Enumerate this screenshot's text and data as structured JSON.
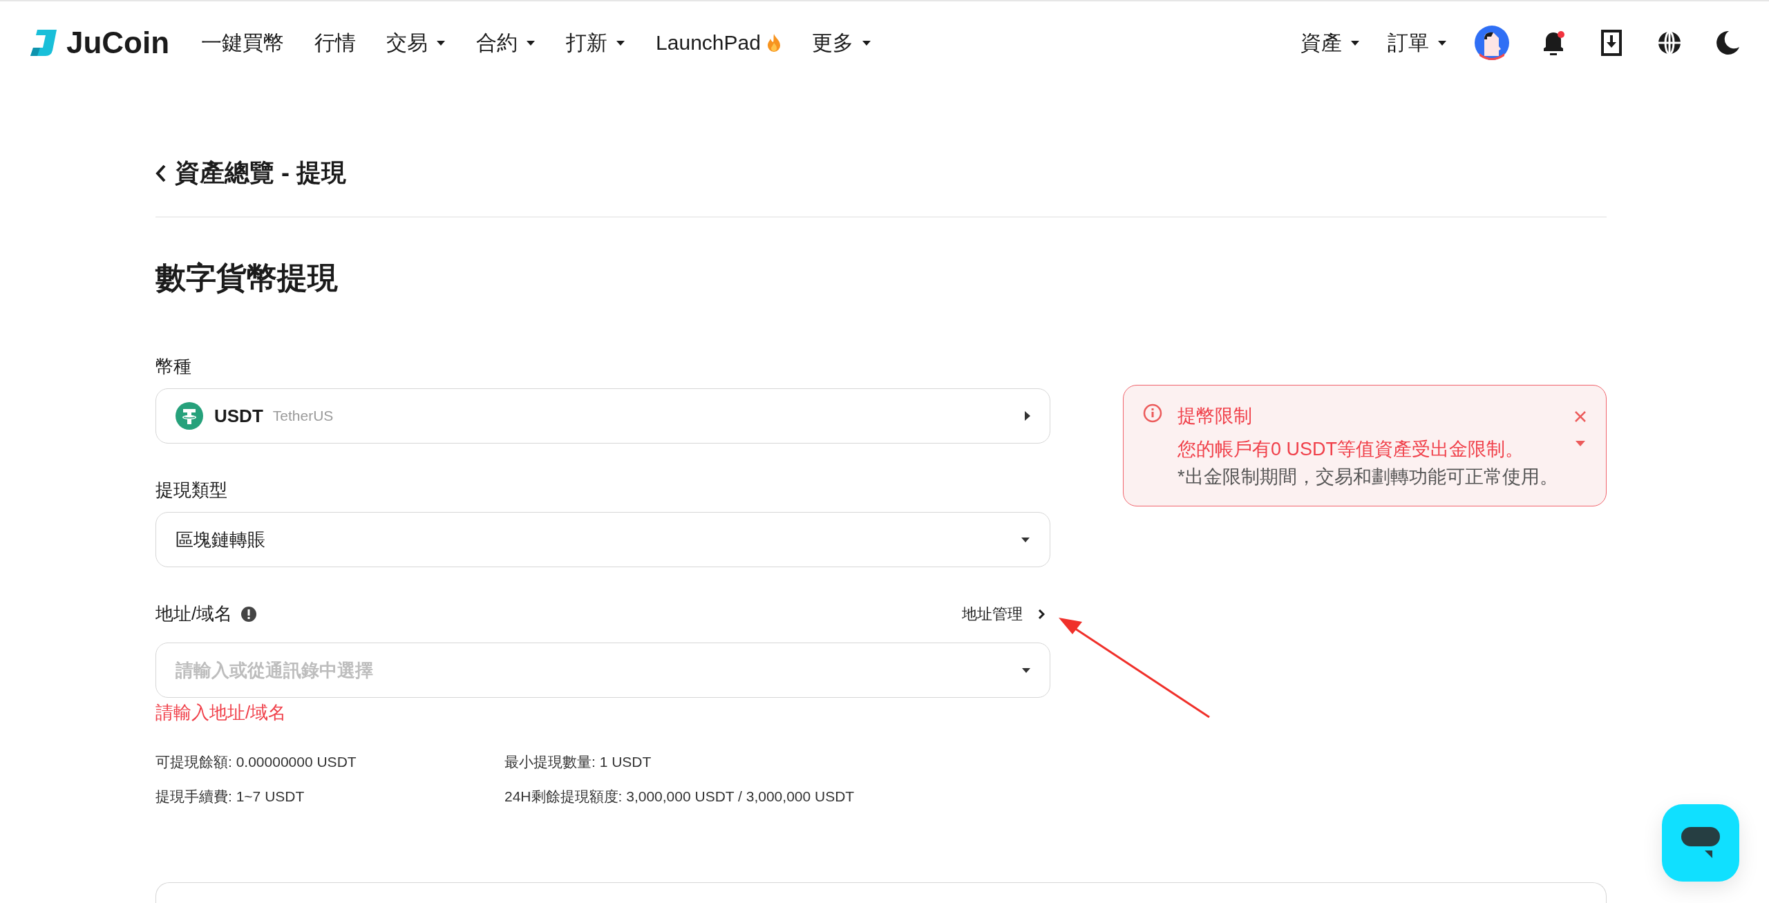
{
  "header": {
    "logo": "JuCoin",
    "nav": [
      {
        "label": "一鍵買幣",
        "kind": "plain"
      },
      {
        "label": "行情",
        "kind": "plain"
      },
      {
        "label": "交易",
        "kind": "dropdown"
      },
      {
        "label": "合約",
        "kind": "dropdown"
      },
      {
        "label": "打新",
        "kind": "dropdown"
      },
      {
        "label": "LaunchPad",
        "kind": "hot"
      },
      {
        "label": "更多",
        "kind": "dropdown"
      }
    ],
    "right_menus": [
      {
        "label": "資產"
      },
      {
        "label": "訂單"
      }
    ],
    "notifications_unread": true
  },
  "breadcrumb": "資產總覽 - 提現",
  "page_title": "數字貨幣提現",
  "form": {
    "coin": {
      "label": "幣種",
      "symbol": "USDT",
      "name": "TetherUS"
    },
    "type": {
      "label": "提現類型",
      "value": "區塊鏈轉賬"
    },
    "address": {
      "label": "地址/域名",
      "link": "地址管理",
      "placeholder": "請輸入或從通訊錄中選擇",
      "error": "請輸入地址/域名"
    }
  },
  "info": [
    {
      "label": "可提現餘額: ",
      "value": "0.00000000 USDT"
    },
    {
      "label": "最小提現數量: ",
      "value": "1 USDT"
    },
    {
      "label": "提現手續費: ",
      "value": "1~7 USDT"
    },
    {
      "label": "24H剩餘提現額度: ",
      "value": "3,000,000 USDT / 3,000,000 USDT"
    }
  ],
  "alert": {
    "title": "提幣限制",
    "message": "您的帳戶有0 USDT等值資產受出金限制。",
    "note": "*出金限制期間，交易和劃轉功能可正常使用。"
  }
}
